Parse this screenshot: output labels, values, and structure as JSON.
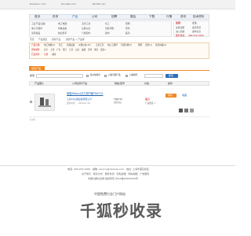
{
  "header": {
    "logos": [
      "Doesxun.com",
      "Dochep.com",
      "Boxttt.com"
    ],
    "nav_items": [
      "首页",
      "供求",
      "产品",
      "公司",
      "招聘",
      "展会",
      "下载",
      "行情",
      "资讯",
      "技术资料"
    ],
    "active_nav": "产品",
    "categories": [
      [
        "工业产品/设备",
        "电工电器",
        "五金工具",
        "化工",
        "照明"
      ],
      [
        "电子元器件",
        "机械设备",
        "仪器仪表",
        "包装印刷",
        "安防"
      ],
      [
        "家居用品",
        "纺织皮革",
        "汽摩配件",
        "建材",
        "医药"
      ]
    ],
    "side_tabs": [
      "会员",
      "企业"
    ],
    "side_lines": [
      "免费注册",
      "会员登录",
      "进入商铺",
      "发布信息",
      "服务热线",
      "400-032-1000"
    ]
  },
  "breadcrumb": [
    "首页",
    "产品频道",
    "其他产品",
    "其他产品 > 产品库"
  ],
  "filters": {
    "line1_label": "产品分类:",
    "line1_items": [
      "电工电器(2)",
      "化工",
      "机械设备",
      "仪器仪表(12)",
      "五金工具",
      "电子元器件",
      "包装印刷(3)",
      "照明",
      "安防(1)",
      "家居用品(5)"
    ],
    "line2_label": "所在地区:",
    "line2_items": [
      "北京",
      "上海",
      "广东",
      "浙江",
      "江苏",
      "山东",
      "福建",
      "天津",
      "重庆",
      "更多>"
    ],
    "line3_label": "已选条件:",
    "line3_items": [
      "全部",
      "清除"
    ]
  },
  "tab": {
    "label": "供应产品"
  },
  "search": {
    "label": "搜索:",
    "placeholder": "",
    "checkboxes": [
      "按价格排序",
      "只看有图产品",
      "只看推荐"
    ],
    "button": "搜索"
  },
  "table": {
    "headers": [
      "产品图片",
      "公司名称/产品",
      "规格/型号",
      "价格",
      "操作"
    ],
    "rows": [
      {
        "title": "美国ABsoco浮力调节器TN9770",
        "company": "上海XX仪器设备有限公司",
        "price_label": "面议",
        "spec": "TN9770",
        "model": "美国进口",
        "action1": "询价",
        "action2": "收藏",
        "date": "2024-07-04",
        "extra_label": "发布时间:",
        "note": "产品数量:1"
      }
    ]
  },
  "pagination": {
    "info": "共1条"
  },
  "footer": {
    "lines": [
      "电话: 400-032-1000 · 邮箱: service@dochep.com · 地址: 上海市浦东新区",
      "关于我们 · 联系方式 · 服务条款 · 隐私政策 · 网站地图 · 广告服务",
      "中国仪器仪表网 版权所有 沪ICP备00000000号"
    ]
  },
  "watermark": {
    "big": "千狐秒收录",
    "small": "中国免费行业门户网站"
  }
}
